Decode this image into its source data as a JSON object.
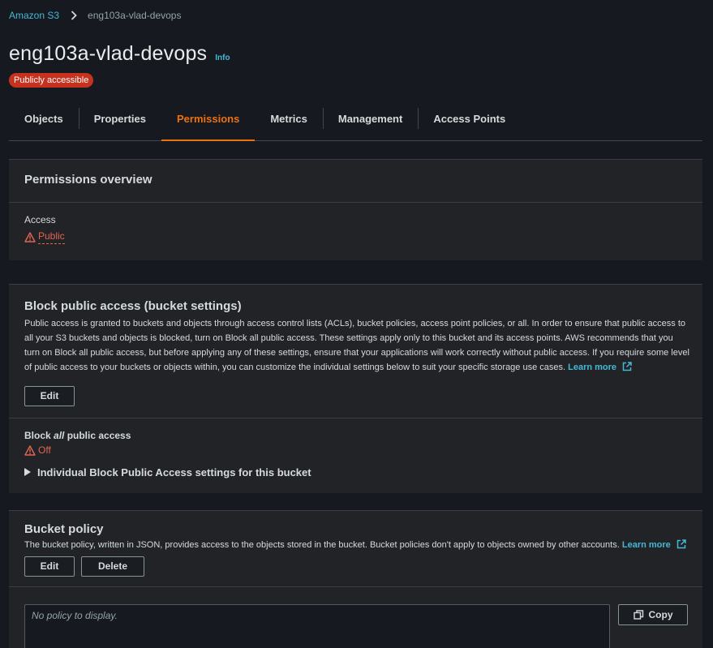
{
  "breadcrumb": {
    "root": "Amazon S3",
    "current": "eng103a-vlad-devops"
  },
  "header": {
    "title": "eng103a-vlad-devops",
    "info": "Info",
    "badge": "Publicly accessible"
  },
  "tabs": [
    {
      "label": "Objects"
    },
    {
      "label": "Properties"
    },
    {
      "label": "Permissions"
    },
    {
      "label": "Metrics"
    },
    {
      "label": "Management"
    },
    {
      "label": "Access Points"
    }
  ],
  "overview": {
    "title": "Permissions overview",
    "access_label": "Access",
    "access_value": "Public"
  },
  "block_public": {
    "title": "Block public access (bucket settings)",
    "description": "Public access is granted to buckets and objects through access control lists (ACLs), bucket policies, access point policies, or all. In order to ensure that public access to all your S3 buckets and objects is blocked, turn on Block all public access. These settings apply only to this bucket and its access points. AWS recommends that you turn on Block all public access, but before applying any of these settings, ensure that your applications will work correctly without public access. If you require some level of public access to your buckets or objects within, you can customize the individual settings below to suit your specific storage use cases.",
    "learn_more": "Learn more",
    "edit": "Edit",
    "block_all_prefix": "Block ",
    "block_all_em": "all",
    "block_all_suffix": " public access",
    "block_all_status": "Off",
    "expander": "Individual Block Public Access settings for this bucket"
  },
  "bucket_policy": {
    "title": "Bucket policy",
    "description": "The bucket policy, written in JSON, provides access to the objects stored in the bucket. Bucket policies don't apply to objects owned by other accounts.",
    "learn_more": "Learn more",
    "edit": "Edit",
    "delete": "Delete",
    "placeholder": "No policy to display.",
    "copy": "Copy"
  },
  "colors": {
    "accent": "#ec7211",
    "link": "#44b9d6",
    "warning": "#e3654d",
    "badge": "#c7321f"
  }
}
